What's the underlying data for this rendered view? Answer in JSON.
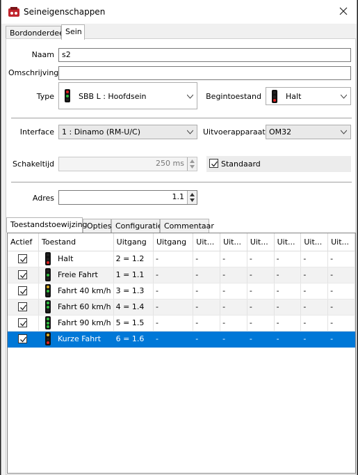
{
  "window": {
    "title": "Seineigenschappen"
  },
  "tabs_top": [
    "Bordonderdeel",
    "Sein"
  ],
  "form": {
    "naam_label": "Naam",
    "naam_value": "s2",
    "omschrijving_label": "Omschrijving",
    "omschrijving_value": "",
    "type_label": "Type",
    "type_value": "SBB L : Hoofdsein",
    "begintoestand_label": "Begintoestand",
    "begintoestand_value": "Halt",
    "interface_label": "Interface",
    "interface_value": "1 : Dinamo (RM-U/C)",
    "uitvoer_label": "Uitvoerapparaat",
    "uitvoer_value": "OM32",
    "schakeltijd_label": "Schakeltijd",
    "schakeltijd_value": "250 ms",
    "standaard_label": "Standaard",
    "adres_label": "Adres",
    "adres_value": "1.1"
  },
  "tabs_bottom": [
    "Toestandstoewijzing",
    "Opties",
    "Configuratie",
    "Commentaar"
  ],
  "grid": {
    "columns": [
      "Actief",
      "Toestand",
      "Uitgang",
      "Uitgang",
      "Uit...",
      "Uit...",
      "Uit...",
      "Uit...",
      "Uit...",
      "Uit..."
    ],
    "rows": [
      {
        "toestand": "Halt",
        "uitgang": "2 = 1.2",
        "lights": [
          "#222",
          "#222",
          "#e02020"
        ]
      },
      {
        "toestand": "Freie Fahrt",
        "uitgang": "1 = 1.1",
        "lights": [
          "#222",
          "#30c040",
          "#222"
        ]
      },
      {
        "toestand": "Fahrt 40 km/h",
        "uitgang": "3 = 1.3",
        "lights": [
          "#e0b020",
          "#30c040",
          "#222"
        ]
      },
      {
        "toestand": "Fahrt 60 km/h",
        "uitgang": "4 = 1.4",
        "lights": [
          "#30c040",
          "#30c040",
          "#222"
        ]
      },
      {
        "toestand": "Fahrt 90 km/h",
        "uitgang": "5 = 1.5",
        "lights": [
          "#30c040",
          "#30c040",
          "#30c040"
        ]
      },
      {
        "toestand": "Kurze Fahrt",
        "uitgang": "6 = 1.6",
        "lights": [
          "#e0b020",
          "#222",
          "#e02020"
        ]
      }
    ],
    "empty": "-",
    "selected_row": 5
  },
  "colors": {
    "selection": "#0078d7"
  }
}
